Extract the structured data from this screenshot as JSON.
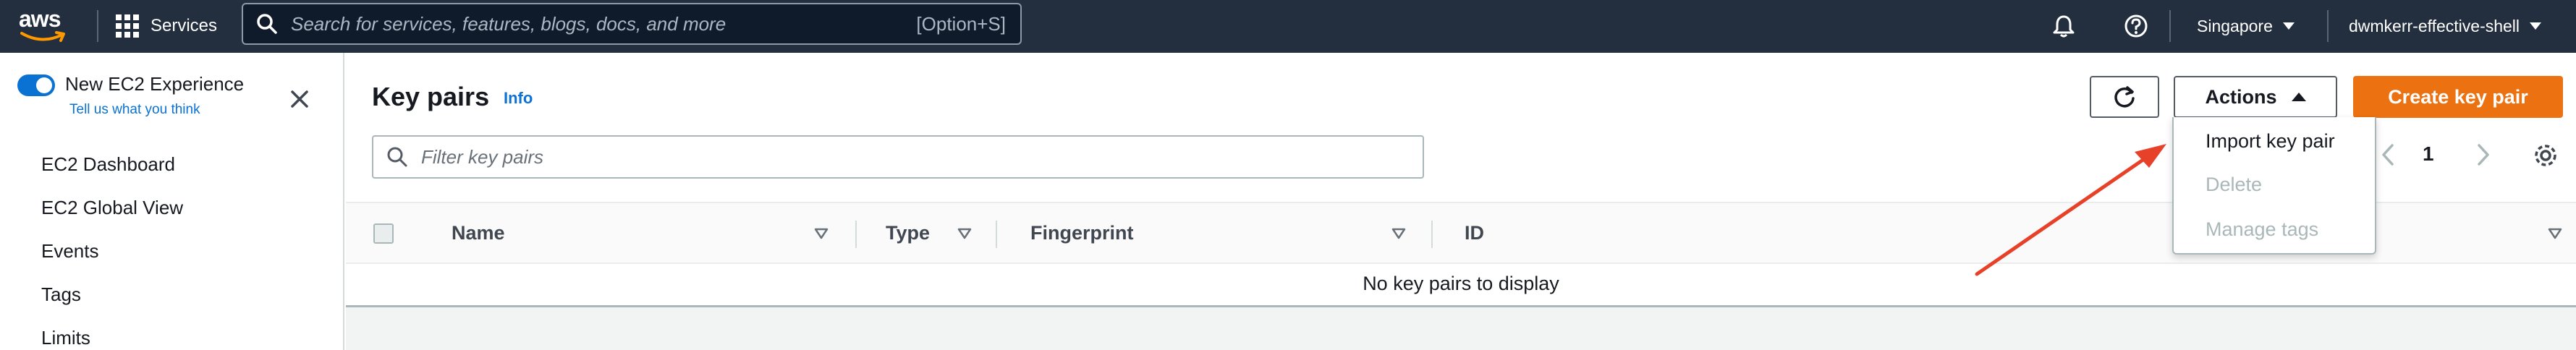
{
  "topnav": {
    "logo_text": "aws",
    "services_label": "Services",
    "search_placeholder": "Search for services, features, blogs, docs, and more",
    "search_shortcut": "[Option+S]",
    "region": "Singapore",
    "account": "dwmkerr-effective-shell"
  },
  "sidebar": {
    "experience_toggle_label": "New EC2 Experience",
    "experience_link": "Tell us what you think",
    "items": [
      {
        "label": "EC2 Dashboard"
      },
      {
        "label": "EC2 Global View"
      },
      {
        "label": "Events"
      },
      {
        "label": "Tags"
      },
      {
        "label": "Limits"
      }
    ]
  },
  "main": {
    "title": "Key pairs",
    "info_link": "Info",
    "actions_label": "Actions",
    "create_label": "Create key pair",
    "filter_placeholder": "Filter key pairs",
    "page_number": "1",
    "columns": [
      {
        "label": "Name"
      },
      {
        "label": "Type"
      },
      {
        "label": "Fingerprint"
      },
      {
        "label": "ID"
      }
    ],
    "empty_message": "No key pairs to display"
  },
  "actions_menu": {
    "items": [
      {
        "label": "Import key pair",
        "enabled": true
      },
      {
        "label": "Delete",
        "enabled": false
      },
      {
        "label": "Manage tags",
        "enabled": false
      }
    ]
  },
  "colors": {
    "nav_bg": "#232f3e",
    "primary_button": "#ec7211",
    "link_blue": "#0972d3",
    "annotation_arrow": "#e8412a"
  },
  "icons": [
    "aws-logo",
    "grid-icon",
    "search-icon",
    "bell-icon",
    "help-icon",
    "close-icon",
    "refresh-icon",
    "caret-up-icon",
    "chevron-left-icon",
    "chevron-right-icon",
    "settings-icon",
    "sort-icon",
    "annotation-arrow"
  ]
}
